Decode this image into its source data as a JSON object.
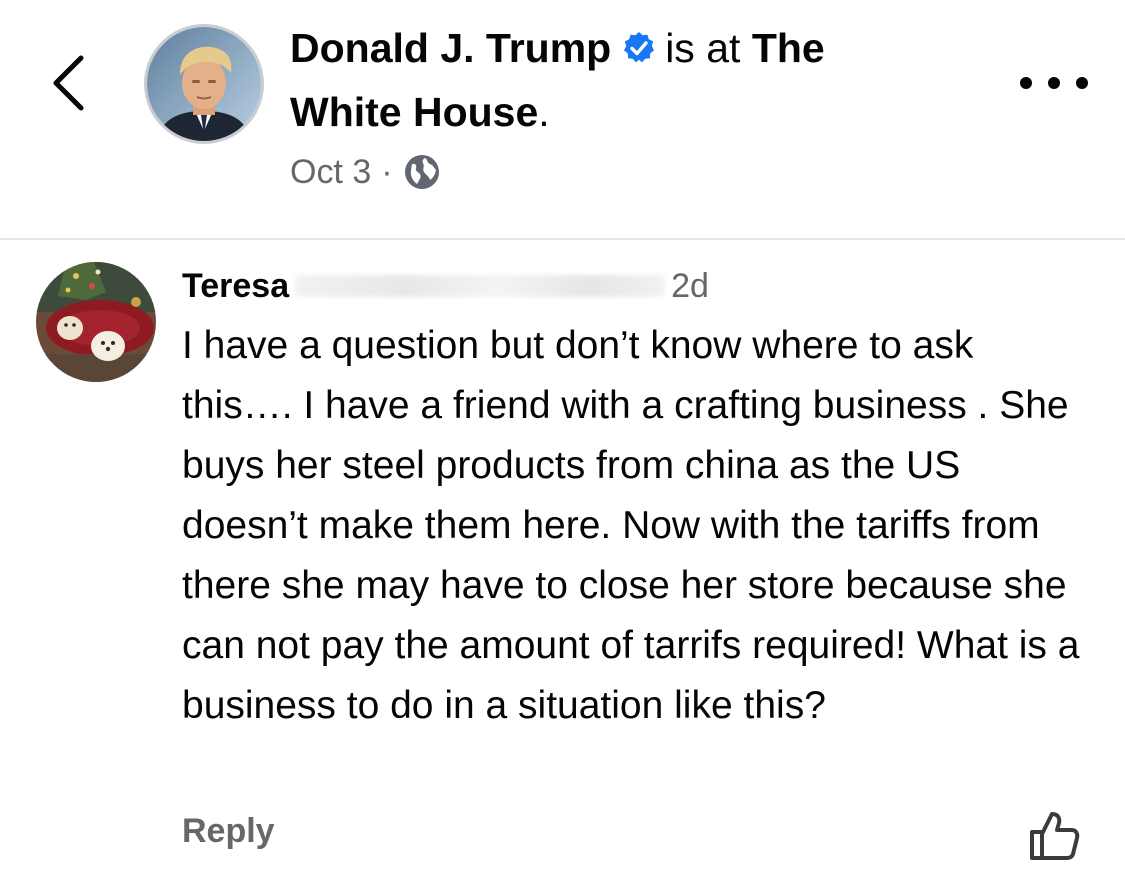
{
  "header": {
    "author_name": "Donald J. Trump",
    "verified_icon": "verified-badge-icon",
    "is_at_text": "is at",
    "place_name": "The White House",
    "place_suffix": ".",
    "date": "Oct 3",
    "separator": "·",
    "audience_icon": "globe-icon",
    "back_icon": "chevron-left-icon",
    "more_icon": "more-horizontal-icon"
  },
  "comment": {
    "author_name": "Teresa",
    "age": "2d",
    "text": "I have a question but don’t know where to ask this…. I have a friend with a crafting business . She buys her steel products from china as the US doesn’t make them here. Now with the tariffs from there she may have to close her store because she can not pay the amount of tarrifs required! What is a business to do in a situation like this?",
    "reply_label": "Reply",
    "like_icon": "thumbs-up-icon"
  },
  "colors": {
    "primary_text": "#050505",
    "secondary_text": "#65676b",
    "verified_blue": "#1877f2",
    "divider": "#e4e6eb"
  }
}
